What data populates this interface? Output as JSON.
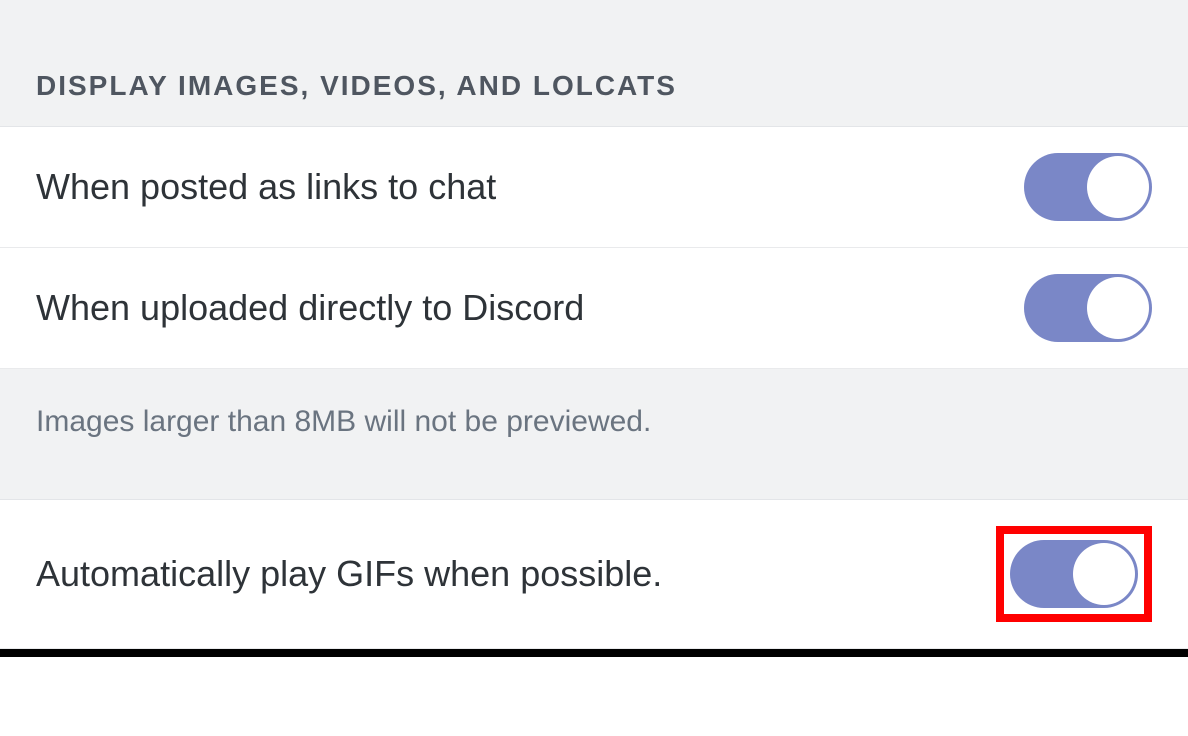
{
  "section": {
    "title": "DISPLAY IMAGES, VIDEOS, AND LOLCATS",
    "rows": [
      {
        "label": "When posted as links to chat",
        "toggle_on": true
      },
      {
        "label": "When uploaded directly to Discord",
        "toggle_on": true
      }
    ],
    "note": "Images larger than 8MB will not be previewed.",
    "gif_row": {
      "label": "Automatically play GIFs when possible.",
      "toggle_on": true
    }
  }
}
